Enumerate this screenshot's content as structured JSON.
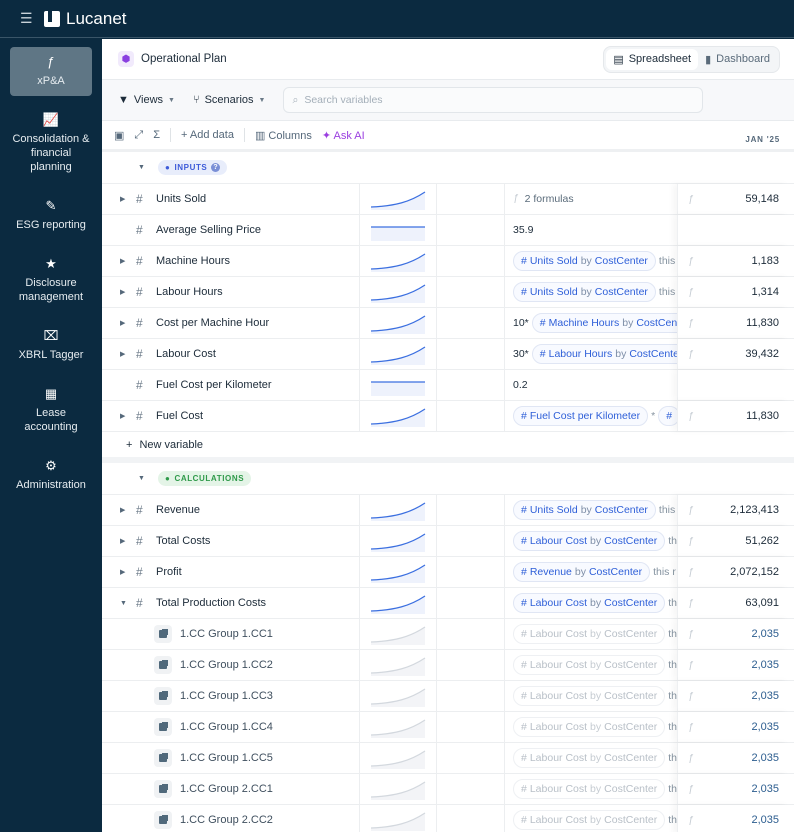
{
  "app": {
    "brand": "Lucanet"
  },
  "sidebar": {
    "items": [
      {
        "label": "xP&A",
        "icon": "formula-circle-icon",
        "glyph": "ƒ",
        "active": true
      },
      {
        "label": "Consolidation & financial planning",
        "icon": "chart-growth-icon",
        "glyph": "📈"
      },
      {
        "label": "ESG reporting",
        "icon": "leaf-icon",
        "glyph": "✎"
      },
      {
        "label": "Disclosure management",
        "icon": "star-document-icon",
        "glyph": "★"
      },
      {
        "label": "XBRL Tagger",
        "icon": "clipboard-x-icon",
        "glyph": "⌧"
      },
      {
        "label": "Lease accounting",
        "icon": "calendar-building-icon",
        "glyph": "▦"
      },
      {
        "label": "Administration",
        "icon": "gear-icon",
        "glyph": "⚙"
      }
    ]
  },
  "header": {
    "title": "Operational Plan",
    "views": {
      "spreadsheet": "Spreadsheet",
      "dashboard": "Dashboard",
      "active": "Spreadsheet"
    }
  },
  "toolbar": {
    "views": "Views",
    "scenarios": "Scenarios",
    "search_placeholder": "Search variables"
  },
  "toolbar2": {
    "add_data": "Add data",
    "columns": "Columns",
    "ask_ai": "Ask AI",
    "month": "JAN '25"
  },
  "sections": [
    {
      "label": "INPUTS",
      "color": "#3d5bd9",
      "rows": [
        {
          "name": "Units Sold",
          "expand": true,
          "spark": "up",
          "formula": {
            "note": "2 formulas"
          },
          "value": "59,148"
        },
        {
          "name": "Average Selling Price",
          "spark": "flat",
          "formula": {
            "prefix": "35.9"
          },
          "value": ""
        },
        {
          "name": "Machine Hours",
          "expand": true,
          "spark": "up",
          "formula": {
            "var": "Units Sold",
            "by": "by",
            "dim": "CostCenter",
            "suffix": "this"
          },
          "value": "1,183"
        },
        {
          "name": "Labour Hours",
          "expand": true,
          "spark": "up",
          "formula": {
            "var": "Units Sold",
            "by": "by",
            "dim": "CostCenter",
            "suffix": "this"
          },
          "value": "1,314"
        },
        {
          "name": "Cost per Machine Hour",
          "expand": true,
          "spark": "up",
          "formula": {
            "prefix": "10*",
            "var": "Machine Hours",
            "by": "by",
            "dim": "CostCenter"
          },
          "value": "11,830"
        },
        {
          "name": "Labour Cost",
          "expand": true,
          "spark": "up",
          "formula": {
            "prefix": "30*",
            "var": "Labour Hours",
            "by": "by",
            "dim": "CostCenter"
          },
          "value": "39,432"
        },
        {
          "name": "Fuel Cost per Kilometer",
          "spark": "flat",
          "formula": {
            "prefix": "0.2"
          },
          "value": ""
        },
        {
          "name": "Fuel Cost",
          "expand": true,
          "spark": "up",
          "formula": {
            "var": "Fuel Cost per Kilometer",
            "suffix": "*",
            "extra": true
          },
          "value": "11,830"
        }
      ],
      "new_variable": "New variable"
    },
    {
      "label": "CALCULATIONS",
      "color": "#2f9a4a",
      "rows": [
        {
          "name": "Revenue",
          "expand": true,
          "spark": "up",
          "formula": {
            "var": "Units Sold",
            "by": "by",
            "dim": "CostCenter",
            "suffix": "this"
          },
          "value": "2,123,413"
        },
        {
          "name": "Total Costs",
          "expand": true,
          "spark": "up",
          "formula": {
            "var": "Labour Cost",
            "by": "by",
            "dim": "CostCenter",
            "suffix": "th"
          },
          "value": "51,262"
        },
        {
          "name": "Profit",
          "expand": true,
          "spark": "up",
          "formula": {
            "var": "Revenue",
            "by": "by",
            "dim": "CostCenter",
            "suffix": "this r"
          },
          "value": "2,072,152"
        },
        {
          "name": "Total Production Costs",
          "expand": true,
          "expanded": true,
          "spark": "up",
          "formula": {
            "var": "Labour Cost",
            "by": "by",
            "dim": "CostCenter",
            "suffix": "th"
          },
          "value": "63,091"
        },
        {
          "name": "1.CC Group 1.CC1",
          "child": true,
          "spark": "grey",
          "formula": {
            "var": "Labour Cost",
            "by": "by",
            "dim": "CostCenter",
            "suffix": "th"
          },
          "value": "2,035"
        },
        {
          "name": "1.CC Group 1.CC2",
          "child": true,
          "spark": "grey",
          "formula": {
            "var": "Labour Cost",
            "by": "by",
            "dim": "CostCenter",
            "suffix": "th"
          },
          "value": "2,035"
        },
        {
          "name": "1.CC Group 1.CC3",
          "child": true,
          "spark": "grey",
          "formula": {
            "var": "Labour Cost",
            "by": "by",
            "dim": "CostCenter",
            "suffix": "th"
          },
          "value": "2,035"
        },
        {
          "name": "1.CC Group 1.CC4",
          "child": true,
          "spark": "grey",
          "formula": {
            "var": "Labour Cost",
            "by": "by",
            "dim": "CostCenter",
            "suffix": "th"
          },
          "value": "2,035"
        },
        {
          "name": "1.CC Group 1.CC5",
          "child": true,
          "spark": "grey",
          "formula": {
            "var": "Labour Cost",
            "by": "by",
            "dim": "CostCenter",
            "suffix": "th"
          },
          "value": "2,035"
        },
        {
          "name": "1.CC Group 2.CC1",
          "child": true,
          "spark": "grey",
          "formula": {
            "var": "Labour Cost",
            "by": "by",
            "dim": "CostCenter",
            "suffix": "th"
          },
          "value": "2,035"
        },
        {
          "name": "1.CC Group 2.CC2",
          "child": true,
          "spark": "grey",
          "formula": {
            "var": "Labour Cost",
            "by": "by",
            "dim": "CostCenter",
            "suffix": "th"
          },
          "value": "2,035"
        }
      ]
    }
  ],
  "colors": {
    "navy": "#0b2a40",
    "accent_blue": "#2e5fd8",
    "ai_purple": "#9b3fe0",
    "spark": "#3b6fe0"
  }
}
